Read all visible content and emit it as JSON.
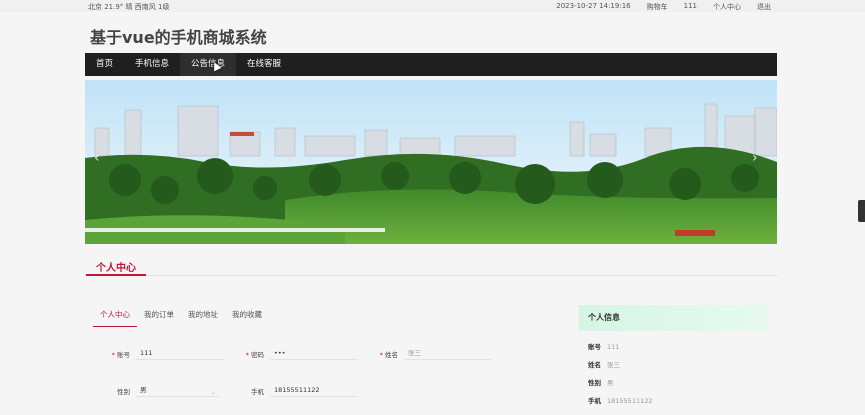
{
  "topbar": {
    "weather": "北京  21.9°  晴  西南风  1级",
    "datetime": "2023-10-27 14:19:16",
    "cart": "购物车",
    "count": "111",
    "center": "个人中心",
    "logout": "退出"
  },
  "site_title": "基于vue的手机商城系统",
  "nav": [
    "首页",
    "手机信息",
    "公告信息",
    "在线客服"
  ],
  "section_title": "个人中心",
  "subtabs": [
    "个人中心",
    "我的订单",
    "我的地址",
    "我的收藏"
  ],
  "form": {
    "account_label": "账号",
    "account_value": "111",
    "password_label": "密码",
    "password_value": "•••",
    "name_label": "姓名",
    "name_placeholder": "张三",
    "gender_label": "性别",
    "gender_value": "男",
    "phone_label": "手机",
    "phone_value": "18155511122",
    "required_mark": "*"
  },
  "info": {
    "title": "个人信息",
    "rows": [
      {
        "k": "账号",
        "v": "111"
      },
      {
        "k": "姓名",
        "v": "张三"
      },
      {
        "k": "性别",
        "v": "男"
      },
      {
        "k": "手机",
        "v": "18155511122"
      }
    ]
  },
  "colors": {
    "accent": "#c0143c",
    "nav_bg": "#1f1f1f",
    "info_bg": "#d5f5e2"
  },
  "icons": {
    "banner_prev": "chevron-left-icon",
    "banner_next": "chevron-right-icon",
    "cursor": "mouse-pointer-icon"
  }
}
